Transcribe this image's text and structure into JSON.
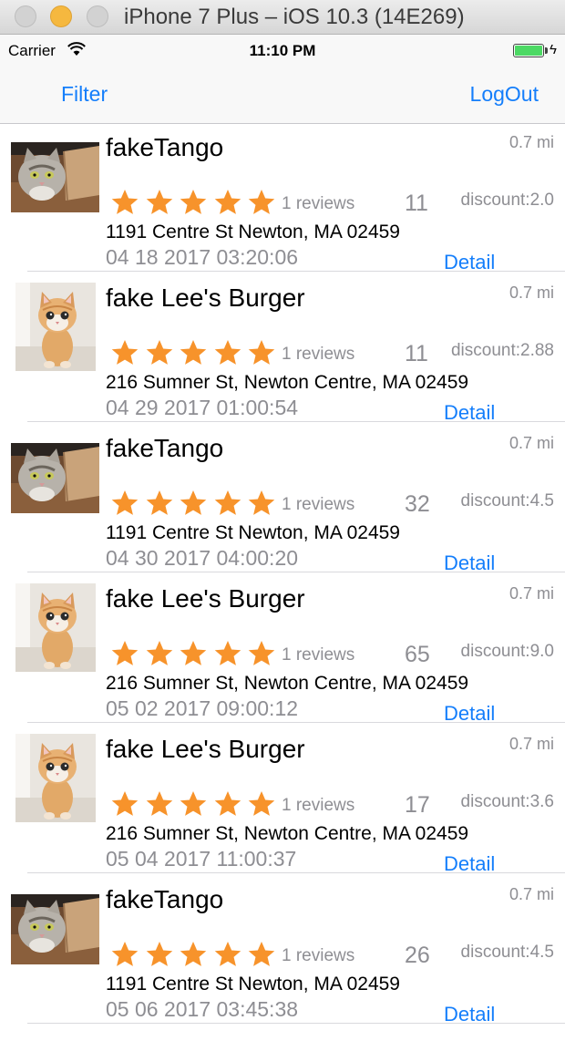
{
  "window": {
    "title": "iPhone 7 Plus – iOS 10.3 (14E269)"
  },
  "status_bar": {
    "carrier": "Carrier",
    "time": "11:10 PM",
    "battery_color": "#4cd964"
  },
  "nav": {
    "left_label": "Filter",
    "right_label": "LogOut",
    "tint": "#147efb"
  },
  "star_color": "#f7932b",
  "items": [
    {
      "name": "fakeTango",
      "distance": "0.7 mi",
      "rating": 5,
      "reviews": "1 reviews",
      "count": "11",
      "discount": "discount:2.0",
      "address": "1191 Centre St Newton, MA 02459",
      "date": "04 18 2017 03:20:06",
      "detail": "Detail",
      "thumb": "cat-in-box-photo"
    },
    {
      "name": "fake Lee's Burger",
      "distance": "0.7 mi",
      "rating": 5,
      "reviews": "1 reviews",
      "count": "11",
      "discount": "discount:2.88",
      "address": "216 Sumner St, Newton Centre, MA 02459",
      "date": "04 29 2017 01:00:54",
      "detail": "Detail",
      "thumb": "kitten-photo"
    },
    {
      "name": "fakeTango",
      "distance": "0.7 mi",
      "rating": 5,
      "reviews": "1 reviews",
      "count": "32",
      "discount": "discount:4.5",
      "address": "1191 Centre St Newton, MA 02459",
      "date": "04 30 2017 04:00:20",
      "detail": "Detail",
      "thumb": "cat-in-box-photo"
    },
    {
      "name": "fake Lee's Burger",
      "distance": "0.7 mi",
      "rating": 5,
      "reviews": "1 reviews",
      "count": "65",
      "discount": "discount:9.0",
      "address": "216 Sumner St, Newton Centre, MA 02459",
      "date": "05 02 2017 09:00:12",
      "detail": "Detail",
      "thumb": "kitten-photo"
    },
    {
      "name": "fake Lee's Burger",
      "distance": "0.7 mi",
      "rating": 5,
      "reviews": "1 reviews",
      "count": "17",
      "discount": "discount:3.6",
      "address": "216 Sumner St, Newton Centre, MA 02459",
      "date": "05 04 2017 11:00:37",
      "detail": "Detail",
      "thumb": "kitten-photo"
    },
    {
      "name": "fakeTango",
      "distance": "0.7 mi",
      "rating": 5,
      "reviews": "1 reviews",
      "count": "26",
      "discount": "discount:4.5",
      "address": "1191 Centre St Newton, MA 02459",
      "date": "05 06 2017 03:45:38",
      "detail": "Detail",
      "thumb": "cat-in-box-photo"
    }
  ]
}
